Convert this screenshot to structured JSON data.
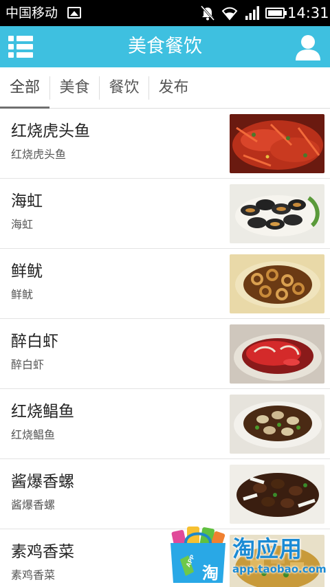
{
  "status_bar": {
    "carrier": "中国移动",
    "time": "14:31",
    "icons": [
      "image-icon",
      "mute-icon",
      "wifi-icon",
      "signal-icon",
      "battery-icon"
    ]
  },
  "app_bar": {
    "title": "美食餐饮",
    "background": "#3ec0e0",
    "left_icon": "menu-list-icon",
    "right_icon": "user-icon"
  },
  "tabs": [
    {
      "label": "全部",
      "active": true
    },
    {
      "label": "美食",
      "active": false
    },
    {
      "label": "餐饮",
      "active": false
    },
    {
      "label": "发布",
      "active": false
    }
  ],
  "items": [
    {
      "title": "红烧虎头鱼",
      "subtitle": "红烧虎头鱼",
      "image": "braised-fish-photo"
    },
    {
      "title": "海虹",
      "subtitle": "海虹",
      "image": "mussels-photo"
    },
    {
      "title": "鲜鱿",
      "subtitle": "鲜鱿",
      "image": "squid-photo"
    },
    {
      "title": "醉白虾",
      "subtitle": "醉白虾",
      "image": "drunken-shrimp-photo"
    },
    {
      "title": "红烧鲳鱼",
      "subtitle": "红烧鲳鱼",
      "image": "braised-pomfret-photo"
    },
    {
      "title": "酱爆香螺",
      "subtitle": "酱爆香螺",
      "image": "sauteed-snails-photo"
    },
    {
      "title": "素鸡香菜",
      "subtitle": "素鸡香菜",
      "image": "vegetarian-chicken-photo"
    }
  ],
  "watermark": {
    "title": "淘应用",
    "url": "app.taobao.com",
    "badge": "APP",
    "bag_char": "淘"
  }
}
